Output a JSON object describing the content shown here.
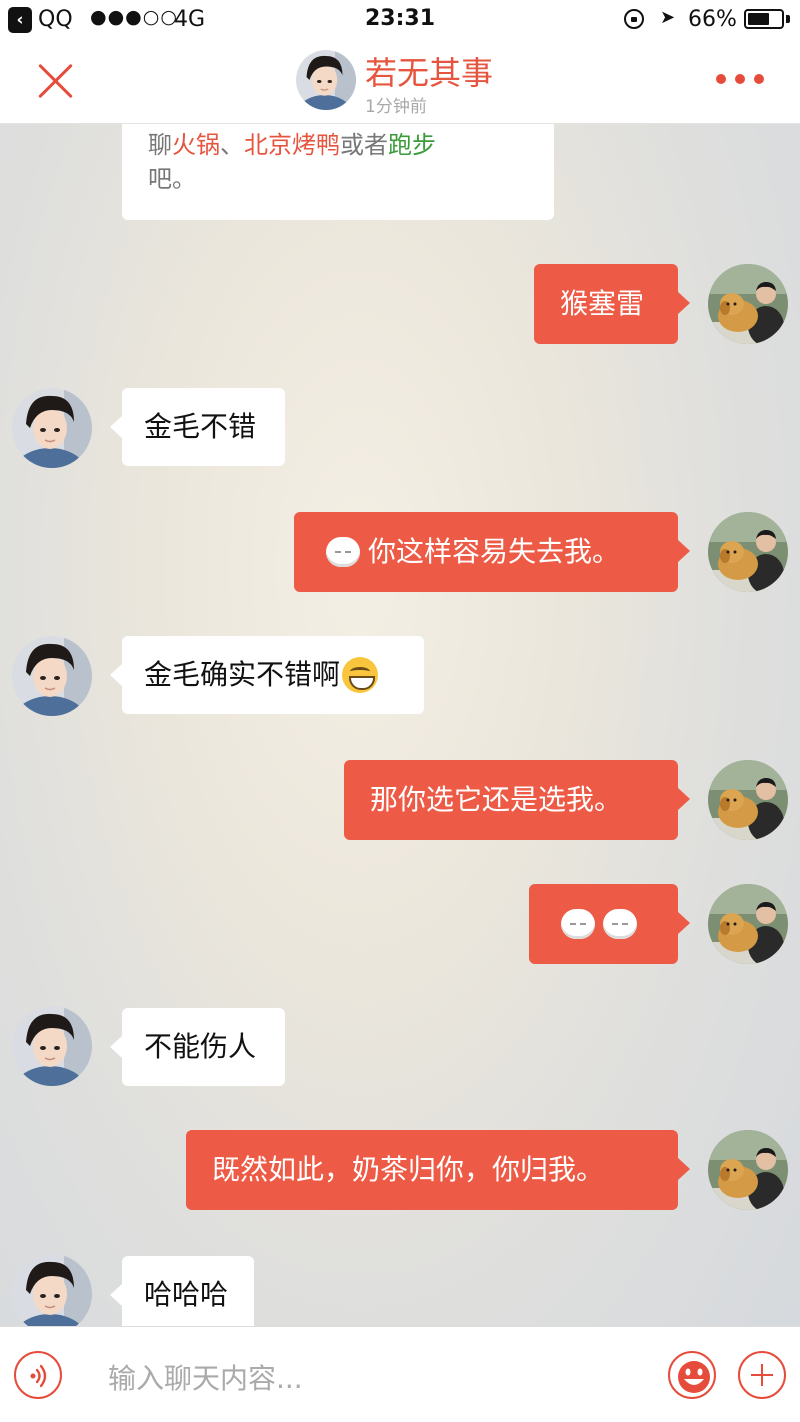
{
  "status_bar": {
    "app": "QQ",
    "signal": "●●●○○",
    "network": "4G",
    "time": "23:31",
    "battery": "66%",
    "battery_level": 0.66
  },
  "header": {
    "title": "若无其事",
    "subtitle": "1分钟前"
  },
  "messages": [
    {
      "side": "in",
      "parts": [
        "聊",
        "火锅",
        "、",
        "北京烤鸭",
        "或者",
        "跑步",
        "吧。"
      ]
    },
    {
      "side": "out",
      "text": "猴塞雷"
    },
    {
      "side": "in",
      "text": "金毛不错"
    },
    {
      "side": "out",
      "text": "你这样容易失去我。",
      "emoji": "white-face"
    },
    {
      "side": "in",
      "text": "金毛确实不错啊",
      "emoji": "grin"
    },
    {
      "side": "out",
      "text": "那你选它还是选我。"
    },
    {
      "side": "out",
      "text": "",
      "emoji": "white-face-x2"
    },
    {
      "side": "in",
      "text": "不能伤人"
    },
    {
      "side": "out",
      "text": "既然如此，奶茶归你，你归我。"
    },
    {
      "side": "in",
      "text": "哈哈哈"
    }
  ],
  "input": {
    "placeholder": "输入聊天内容..."
  },
  "colors": {
    "accent": "#e64c3c",
    "bubble_out": "#ed5a45",
    "bubble_in": "#ffffff",
    "highlight_green": "#3a9b3a"
  },
  "icons": {
    "close": "close-icon",
    "more": "more-dots-icon",
    "voice": "voice-icon",
    "emoji": "emoji-icon",
    "plus": "plus-icon"
  }
}
